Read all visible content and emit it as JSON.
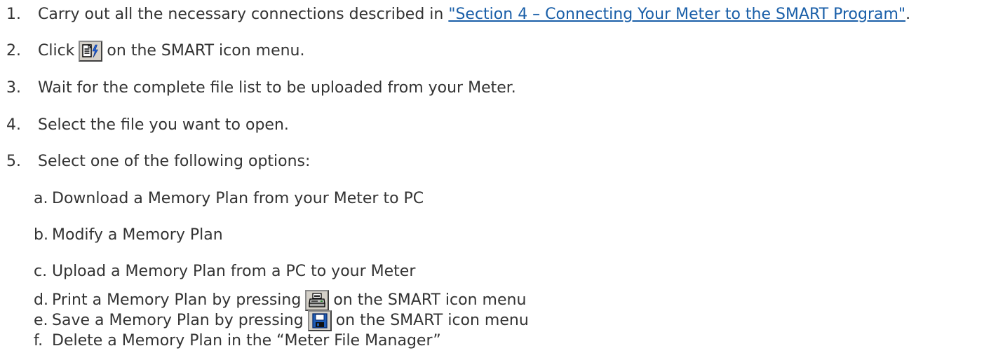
{
  "steps": [
    {
      "num": "1.",
      "text_before": "Carry out all the necessary connections described in ",
      "link": "\"Section 4 – Connecting Your Meter to the SMART Program\"",
      "text_after": "."
    },
    {
      "num": "2.",
      "text_before": "Click",
      "icon": "open-meter-file-icon",
      "text_after": "on the SMART icon menu."
    },
    {
      "num": "3.",
      "text": "Wait for the complete file list to be uploaded from your Meter."
    },
    {
      "num": "4.",
      "text": "Select the file you want to open."
    },
    {
      "num": "5.",
      "text": "Select one of the following options:"
    }
  ],
  "options": [
    {
      "letter": "a.",
      "text": "Download a Memory Plan from your Meter to PC"
    },
    {
      "letter": "b.",
      "text": "Modify a Memory Plan"
    },
    {
      "letter": "c.",
      "text": "Upload a Memory Plan from a PC to your Meter"
    },
    {
      "letter": "d.",
      "text_before": "Print a Memory Plan by pressing",
      "icon": "printer-icon",
      "text_after": "on the SMART icon menu"
    },
    {
      "letter": "e.",
      "text_before": "Save a Memory Plan by pressing",
      "icon": "floppy-disk-icon",
      "text_after": "on the SMART icon menu"
    },
    {
      "letter": "f.",
      "text": "Delete a Memory Plan in the “Meter File Manager”"
    }
  ],
  "colors": {
    "text": "#333333",
    "link": "#1a5fa8",
    "icon_face": "#d4d0c8"
  }
}
